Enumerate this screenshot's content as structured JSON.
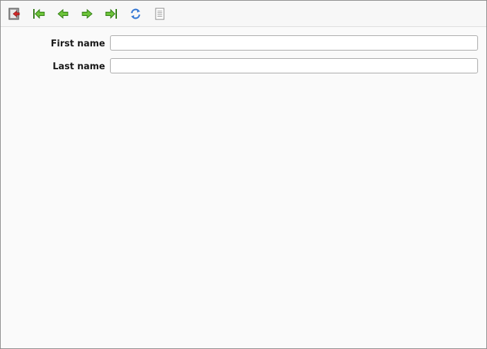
{
  "toolbar": {
    "buttons": [
      {
        "icon": "exit-icon",
        "tooltip": ""
      },
      {
        "icon": "first-record-icon",
        "tooltip": ""
      },
      {
        "icon": "previous-record-icon",
        "tooltip": ""
      },
      {
        "icon": "next-record-icon",
        "tooltip": ""
      },
      {
        "icon": "last-record-icon",
        "tooltip": ""
      },
      {
        "icon": "refresh-icon",
        "tooltip": ""
      },
      {
        "icon": "document-icon",
        "tooltip": ""
      }
    ]
  },
  "form": {
    "first_name": {
      "label": "First name",
      "value": ""
    },
    "last_name": {
      "label": "Last name",
      "value": ""
    }
  },
  "colors": {
    "arrow_green": "#5cb82a",
    "arrow_dark_green": "#2f7a12",
    "refresh_blue": "#3a7bd5",
    "exit_red": "#d42a2a"
  }
}
